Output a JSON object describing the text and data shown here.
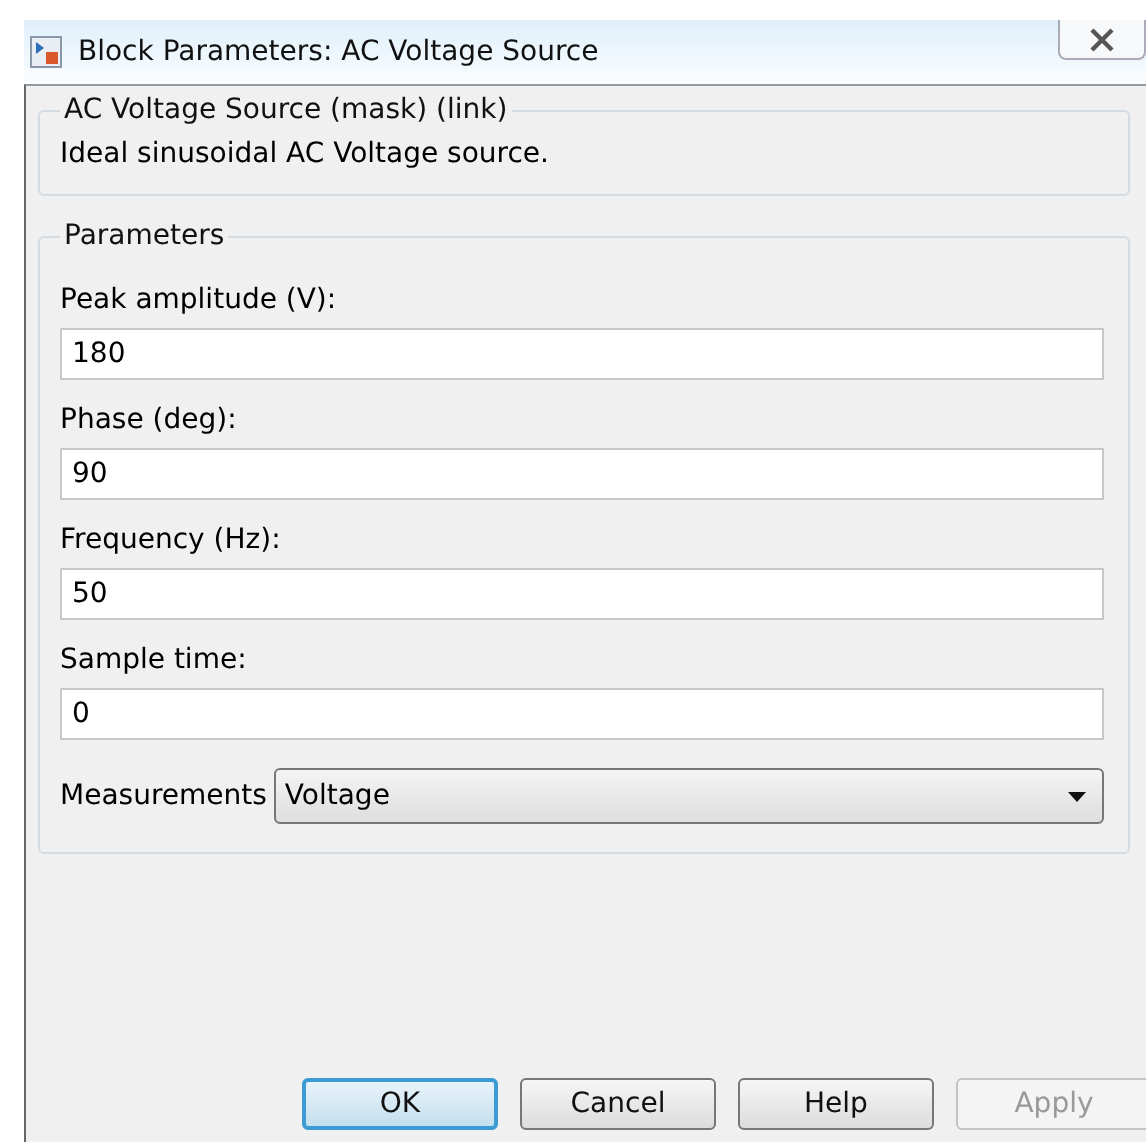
{
  "window": {
    "title": "Block Parameters: AC Voltage Source"
  },
  "description_group": {
    "title": "AC Voltage Source (mask) (link)",
    "text": "Ideal sinusoidal AC Voltage source."
  },
  "parameters": {
    "title": "Parameters",
    "fields": [
      {
        "label": "Peak amplitude (V):",
        "value": "180"
      },
      {
        "label": "Phase (deg):",
        "value": "90"
      },
      {
        "label": "Frequency (Hz):",
        "value": "50"
      },
      {
        "label": "Sample time:",
        "value": "0"
      }
    ],
    "measurements": {
      "label": "Measurements",
      "value": "Voltage"
    }
  },
  "buttons": [
    {
      "label": "OK",
      "default": true,
      "disabled": false
    },
    {
      "label": "Cancel",
      "default": false,
      "disabled": false
    },
    {
      "label": "Help",
      "default": false,
      "disabled": false
    },
    {
      "label": "Apply",
      "default": false,
      "disabled": true
    }
  ]
}
